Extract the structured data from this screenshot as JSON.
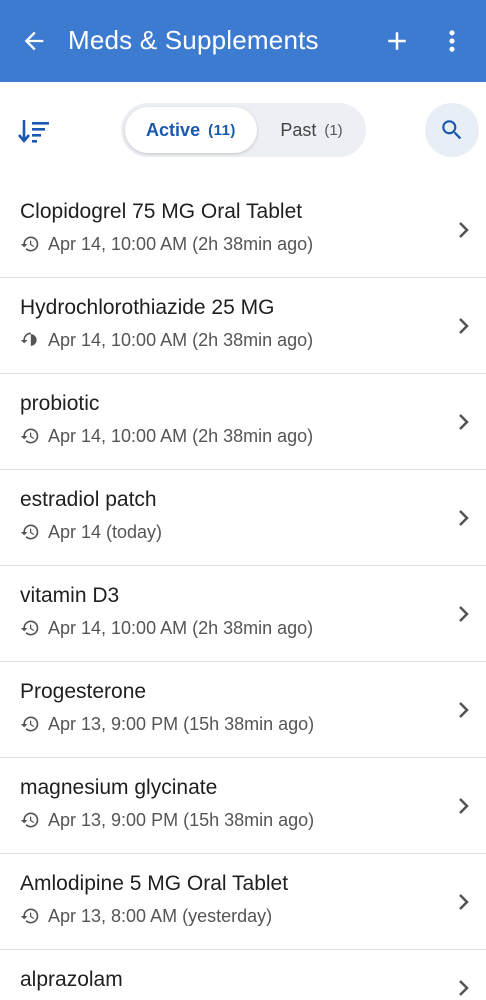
{
  "header": {
    "title": "Meds & Supplements",
    "back_icon": "arrow-left-icon",
    "add_icon": "plus-icon",
    "more_icon": "more-vert-icon"
  },
  "toolbar": {
    "sort_icon": "sort-icon",
    "tabs": [
      {
        "label": "Active",
        "count": "(11)",
        "selected": true
      },
      {
        "label": "Past",
        "count": "(1)",
        "selected": false
      }
    ],
    "search_icon": "search-icon"
  },
  "colors": {
    "appbar": "#3d7bd0",
    "accent": "#1b58b0",
    "divider": "#dcdcdc"
  },
  "meds": [
    {
      "name": "Clopidogrel 75 MG Oral Tablet",
      "last": "Apr 14, 10:00 AM (2h 38min ago)"
    },
    {
      "name": "Hydrochlorothiazide 25 MG",
      "last": "Apr 14, 10:00 AM (2h 38min ago)"
    },
    {
      "name": "probiotic",
      "last": "Apr 14, 10:00 AM (2h 38min ago)"
    },
    {
      "name": "estradiol patch",
      "last": "Apr 14 (today)"
    },
    {
      "name": "vitamin D3",
      "last": "Apr 14, 10:00 AM (2h 38min ago)"
    },
    {
      "name": "Progesterone",
      "last": "Apr 13, 9:00 PM (15h 38min ago)"
    },
    {
      "name": "magnesium glycinate",
      "last": "Apr 13, 9:00 PM (15h 38min ago)"
    },
    {
      "name": "Amlodipine 5 MG Oral Tablet",
      "last": "Apr 13, 8:00 AM (yesterday)"
    },
    {
      "name": "alprazolam",
      "last": ""
    }
  ]
}
